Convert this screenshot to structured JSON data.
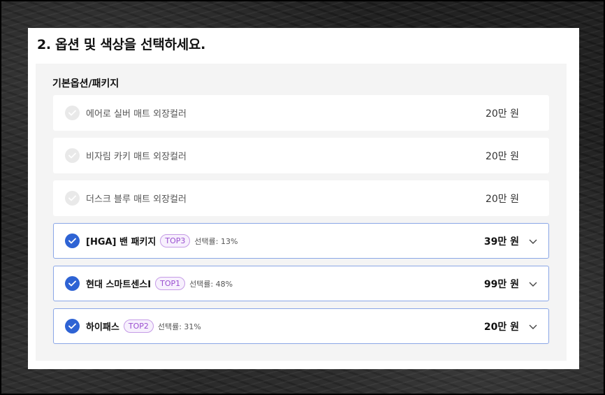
{
  "step_title": "2. 옵션 및 색상을 선택하세요.",
  "section_label": "기본옵션/패키지",
  "colors": {
    "accent": "#2e63d4",
    "selected_border": "#8aa6e6",
    "badge": "#9a4fd0"
  },
  "options": [
    {
      "label": "에어로 실버 매트 외장컬러",
      "price": "20만 원",
      "selected": false
    },
    {
      "label": "비자림 카키 매트 외장컬러",
      "price": "20만 원",
      "selected": false
    },
    {
      "label": "더스크 블루 매트 외장컬러",
      "price": "20만 원",
      "selected": false
    },
    {
      "label": "[HGA] 밴 패키지",
      "badge": "TOP3",
      "rate": "선택률: 13%",
      "price": "39만 원",
      "selected": true
    },
    {
      "label": "현대 스마트센스I",
      "badge": "TOP1",
      "rate": "선택률: 48%",
      "price": "99만 원",
      "selected": true
    },
    {
      "label": "하이패스",
      "badge": "TOP2",
      "rate": "선택률: 31%",
      "price": "20만 원",
      "selected": true
    }
  ]
}
